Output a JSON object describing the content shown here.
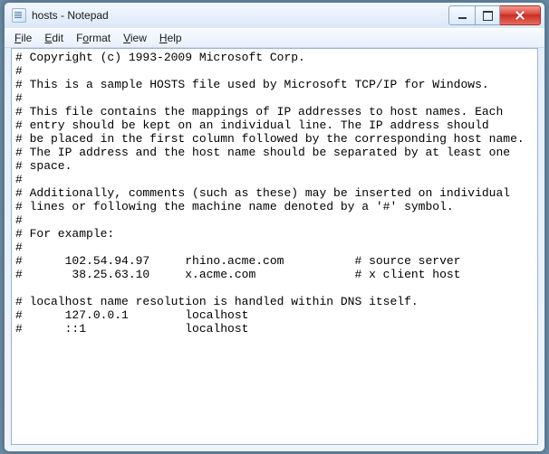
{
  "window": {
    "title": "hosts - Notepad"
  },
  "menu": {
    "file": "File",
    "edit": "Edit",
    "format": "Format",
    "view": "View",
    "help": "Help"
  },
  "document": {
    "text": "# Copyright (c) 1993-2009 Microsoft Corp.\n#\n# This is a sample HOSTS file used by Microsoft TCP/IP for Windows.\n#\n# This file contains the mappings of IP addresses to host names. Each\n# entry should be kept on an individual line. The IP address should\n# be placed in the first column followed by the corresponding host name.\n# The IP address and the host name should be separated by at least one\n# space.\n#\n# Additionally, comments (such as these) may be inserted on individual\n# lines or following the machine name denoted by a '#' symbol.\n#\n# For example:\n#\n#      102.54.94.97     rhino.acme.com          # source server\n#       38.25.63.10     x.acme.com              # x client host\n\n# localhost name resolution is handled within DNS itself.\n#      127.0.0.1        localhost\n#      ::1              localhost"
  }
}
